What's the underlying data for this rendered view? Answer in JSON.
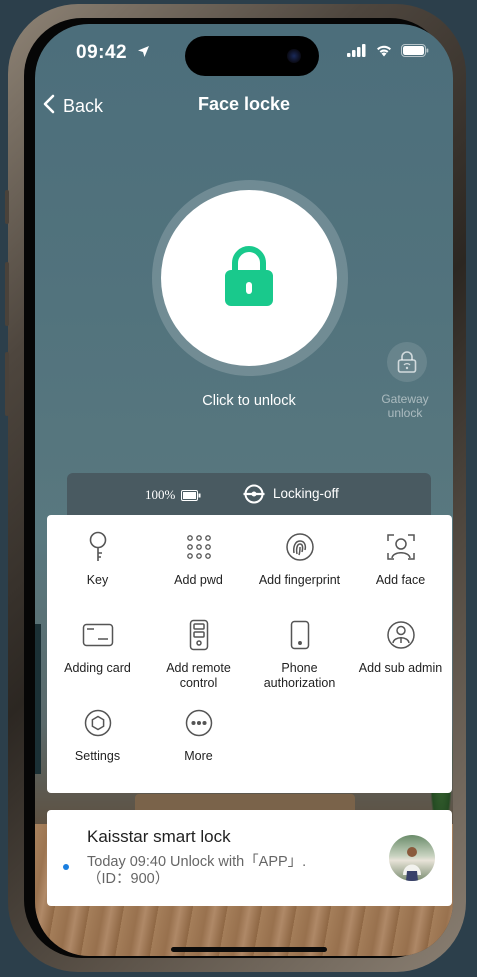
{
  "status_bar": {
    "time": "09:42"
  },
  "nav": {
    "back_label": "Back",
    "title": "Face locke"
  },
  "lock": {
    "action_label": "Click to unlock",
    "gateway_label": "Gateway unlock"
  },
  "info": {
    "battery": "100%",
    "lock_status": "Locking-off"
  },
  "grid": {
    "items": [
      {
        "label": "Key",
        "icon": "key-icon"
      },
      {
        "label": "Add pwd",
        "icon": "keypad-icon"
      },
      {
        "label": "Add fingerprint",
        "icon": "fingerprint-icon"
      },
      {
        "label": "Add face",
        "icon": "face-scan-icon"
      },
      {
        "label": "Adding card",
        "icon": "card-icon"
      },
      {
        "label": "Add remote control",
        "icon": "remote-icon"
      },
      {
        "label": "Phone authorization",
        "icon": "phone-icon"
      },
      {
        "label": "Add sub admin",
        "icon": "sub-admin-icon"
      },
      {
        "label": "Settings",
        "icon": "settings-icon"
      },
      {
        "label": "More",
        "icon": "more-icon"
      }
    ]
  },
  "record": {
    "device_name": "Kaisstar smart lock",
    "latest": "Today 09:40  Unlock with「APP」.（ID：900）"
  },
  "colors": {
    "accent": "#19c98c",
    "record_dot": "#1a7fe0"
  }
}
